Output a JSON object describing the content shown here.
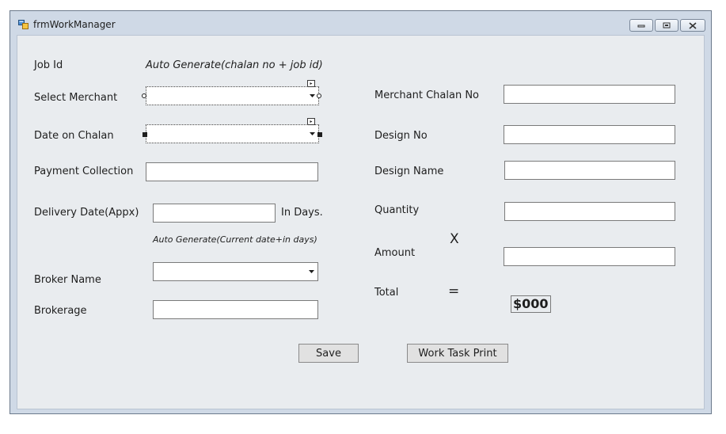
{
  "window": {
    "title": "frmWorkManager",
    "controls": [
      "minimize-icon",
      "maximize-icon",
      "close-icon"
    ]
  },
  "form": {
    "job_id": {
      "label": "Job Id",
      "value": "Auto Generate(chalan no + job id)"
    },
    "select_merchant": {
      "label": "Select Merchant",
      "value": ""
    },
    "date_on_chalan": {
      "label": "Date on Chalan",
      "value": ""
    },
    "payment_collection": {
      "label": "Payment Collection",
      "value": ""
    },
    "delivery_date": {
      "label": "Delivery Date(Appx)",
      "value": "",
      "suffix": "In Days.",
      "hint": "Auto Generate(Current date+in days)"
    },
    "broker_name": {
      "label": "Broker Name",
      "value": ""
    },
    "brokerage": {
      "label": "Brokerage",
      "value": ""
    },
    "merchant_chalan_no": {
      "label": "Merchant Chalan No",
      "value": ""
    },
    "design_no": {
      "label": "Design No",
      "value": ""
    },
    "design_name": {
      "label": "Design Name",
      "value": ""
    },
    "quantity": {
      "label": "Quantity",
      "value": ""
    },
    "multiply_sign": "X",
    "amount": {
      "label": "Amount",
      "value": ""
    },
    "total": {
      "label": "Total",
      "equals_sign": "=",
      "value": "$000"
    }
  },
  "buttons": {
    "save": "Save",
    "work_task_print": "Work Task Print"
  }
}
